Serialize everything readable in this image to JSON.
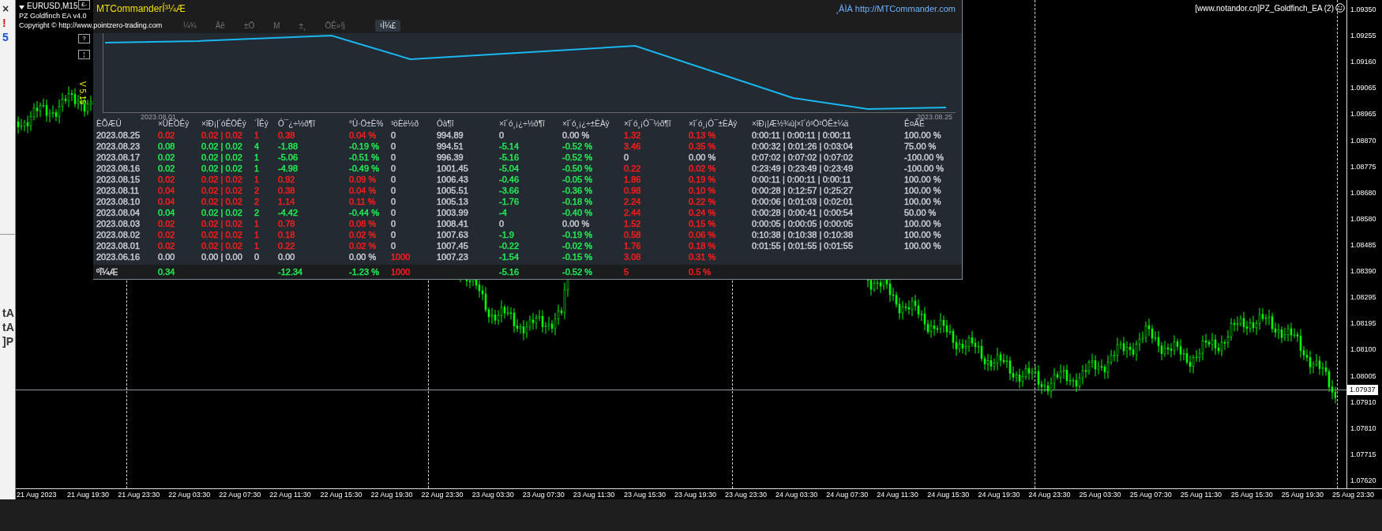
{
  "left_strip": {
    "top": [
      {
        "text": "×",
        "color": "#333333"
      },
      {
        "text": "!",
        "color": "#e01010"
      },
      {
        "text": "5",
        "color": "#1a4fd6"
      }
    ],
    "bottom": [
      {
        "text": "tA",
        "color": "#333333"
      },
      {
        "text": "tA",
        "color": "#333333"
      },
      {
        "text": "]P",
        "color": "#333333"
      }
    ]
  },
  "chart": {
    "symbol": "EURUSD,M15",
    "expert": "PZ Goldfinch EA  v4.0",
    "copyright": "Copyright © http://www.pointzero-trading.com",
    "version": "V 5.15",
    "side_buttons": [
      "£-",
      "?",
      "¦"
    ],
    "info": "[www.notandor.cn]PZ_Goldfinch_EA (2)",
    "current_price": "1.07937",
    "price_axis": [
      "1.09350",
      "1.09255",
      "1.09160",
      "1.09065",
      "1.08965",
      "1.08870",
      "1.08775",
      "1.08680",
      "1.08580",
      "1.08485",
      "1.08390",
      "1.08295",
      "1.08195",
      "1.08100",
      "1.08005",
      "1.07910",
      "1.07810",
      "1.07715",
      "1.07620"
    ],
    "time_axis": [
      "21 Aug 2023",
      "21 Aug 19:30",
      "21 Aug 23:30",
      "22 Aug 03:30",
      "22 Aug 07:30",
      "22 Aug 11:30",
      "22 Aug 15:30",
      "22 Aug 19:30",
      "22 Aug 23:30",
      "23 Aug 03:30",
      "23 Aug 07:30",
      "23 Aug 11:30",
      "23 Aug 15:30",
      "23 Aug 19:30",
      "23 Aug 23:30",
      "24 Aug 03:30",
      "24 Aug 07:30",
      "24 Aug 11:30",
      "24 Aug 15:30",
      "24 Aug 19:30",
      "24 Aug 23:30",
      "25 Aug 03:30",
      "25 Aug 07:30",
      "25 Aug 11:30",
      "25 Aug 15:30",
      "25 Aug 19:30",
      "25 Aug 23:30"
    ]
  },
  "panel": {
    "title": "MTCommanderÍ³¼Æ",
    "link": "¸ÂÌÀ http://MTCommander.com",
    "tabs": [
      {
        "label": "¼¾",
        "selected": false
      },
      {
        "label": "Äê",
        "selected": false
      },
      {
        "label": "±Ö",
        "selected": false
      },
      {
        "label": "M",
        "selected": false
      },
      {
        "label": "±¸",
        "selected": false
      },
      {
        "label": "ÖÊ»§",
        "selected": false
      },
      {
        "label": "¹Ì¼£",
        "selected": true
      }
    ],
    "equity": {
      "start_label": "2023.08.01",
      "end_label": "2023.08.25"
    },
    "table": {
      "columns": [
        "ÈÕÆÚ",
        "×ÜÊÖÊý",
        "×îÐ¡|´óÊÖÊý",
        "´ÎÊý",
        "Ó¯¿÷½ð¶î",
        "°Ù·Ö±È%",
        "³öÈë½ð",
        "Óà¶î",
        "×î´ó¸¡¿÷½ð¶î",
        "×î´ó¸¡¿÷±ÈÀý",
        "×î´ó¸¡Ó¯½ð¶î",
        "×î´ó¸¡Ó¯±ÈÀý",
        "×îÐ¡|Æ½¾ù|×î´ó³Ö²ÖÊ±¼ä",
        "Ê¤ÂÊ"
      ],
      "rows": [
        {
          "cells": [
            {
              "text": "2023.08.25",
              "color": "#c9cdd3"
            },
            {
              "text": "0.02",
              "color": "#ff1c1c"
            },
            {
              "text": "0.02 | 0.02",
              "color": "#ff1c1c"
            },
            {
              "text": "1",
              "color": "#ff1c1c"
            },
            {
              "text": "0.38",
              "color": "#ff1c1c"
            },
            {
              "text": "0.04 %",
              "color": "#ff1c1c"
            },
            {
              "text": "0",
              "color": "#c9cdd3"
            },
            {
              "text": "994.89",
              "color": "#c9cdd3"
            },
            {
              "text": "0",
              "color": "#c9cdd3"
            },
            {
              "text": "0.00 %",
              "color": "#c9cdd3"
            },
            {
              "text": "1.32",
              "color": "#ff1c1c"
            },
            {
              "text": "0.13 %",
              "color": "#ff1c1c"
            },
            {
              "text": "0:00:11 | 0:00:11 | 0:00:11",
              "color": "#c9cdd3"
            },
            {
              "text": "100.00 %",
              "color": "#c9cdd3"
            }
          ]
        },
        {
          "cells": [
            {
              "text": "2023.08.23",
              "color": "#c9cdd3"
            },
            {
              "text": "0.08",
              "color": "#22ee55"
            },
            {
              "text": "0.02 | 0.02",
              "color": "#22ee55"
            },
            {
              "text": "4",
              "color": "#22ee55"
            },
            {
              "text": "-1.88",
              "color": "#22ee55"
            },
            {
              "text": "-0.19 %",
              "color": "#22ee55"
            },
            {
              "text": "0",
              "color": "#c9cdd3"
            },
            {
              "text": "994.51",
              "color": "#c9cdd3"
            },
            {
              "text": "-5.14",
              "color": "#22ee55"
            },
            {
              "text": "-0.52 %",
              "color": "#22ee55"
            },
            {
              "text": "3.46",
              "color": "#ff1c1c"
            },
            {
              "text": "0.35 %",
              "color": "#ff1c1c"
            },
            {
              "text": "0:00:32 | 0:01:26 | 0:03:04",
              "color": "#c9cdd3"
            },
            {
              "text": "75.00 %",
              "color": "#c9cdd3"
            }
          ]
        },
        {
          "cells": [
            {
              "text": "2023.08.17",
              "color": "#c9cdd3"
            },
            {
              "text": "0.02",
              "color": "#22ee55"
            },
            {
              "text": "0.02 | 0.02",
              "color": "#22ee55"
            },
            {
              "text": "1",
              "color": "#22ee55"
            },
            {
              "text": "-5.06",
              "color": "#22ee55"
            },
            {
              "text": "-0.51 %",
              "color": "#22ee55"
            },
            {
              "text": "0",
              "color": "#c9cdd3"
            },
            {
              "text": "996.39",
              "color": "#c9cdd3"
            },
            {
              "text": "-5.16",
              "color": "#22ee55"
            },
            {
              "text": "-0.52 %",
              "color": "#22ee55"
            },
            {
              "text": "0",
              "color": "#c9cdd3"
            },
            {
              "text": "0.00 %",
              "color": "#c9cdd3"
            },
            {
              "text": "0:07:02 | 0:07:02 | 0:07:02",
              "color": "#c9cdd3"
            },
            {
              "text": "-100.00 %",
              "color": "#c9cdd3"
            }
          ]
        },
        {
          "cells": [
            {
              "text": "2023.08.16",
              "color": "#c9cdd3"
            },
            {
              "text": "0.02",
              "color": "#22ee55"
            },
            {
              "text": "0.02 | 0.02",
              "color": "#22ee55"
            },
            {
              "text": "1",
              "color": "#22ee55"
            },
            {
              "text": "-4.98",
              "color": "#22ee55"
            },
            {
              "text": "-0.49 %",
              "color": "#22ee55"
            },
            {
              "text": "0",
              "color": "#c9cdd3"
            },
            {
              "text": "1001.45",
              "color": "#c9cdd3"
            },
            {
              "text": "-5.04",
              "color": "#22ee55"
            },
            {
              "text": "-0.50 %",
              "color": "#22ee55"
            },
            {
              "text": "0.22",
              "color": "#ff1c1c"
            },
            {
              "text": "0.02 %",
              "color": "#ff1c1c"
            },
            {
              "text": "0:23:49 | 0:23:49 | 0:23:49",
              "color": "#c9cdd3"
            },
            {
              "text": "-100.00 %",
              "color": "#c9cdd3"
            }
          ]
        },
        {
          "cells": [
            {
              "text": "2023.08.15",
              "color": "#c9cdd3"
            },
            {
              "text": "0.02",
              "color": "#ff1c1c"
            },
            {
              "text": "0.02 | 0.02",
              "color": "#ff1c1c"
            },
            {
              "text": "1",
              "color": "#ff1c1c"
            },
            {
              "text": "0.92",
              "color": "#ff1c1c"
            },
            {
              "text": "0.09 %",
              "color": "#ff1c1c"
            },
            {
              "text": "0",
              "color": "#c9cdd3"
            },
            {
              "text": "1006.43",
              "color": "#c9cdd3"
            },
            {
              "text": "-0.46",
              "color": "#22ee55"
            },
            {
              "text": "-0.05 %",
              "color": "#22ee55"
            },
            {
              "text": "1.86",
              "color": "#ff1c1c"
            },
            {
              "text": "0.19 %",
              "color": "#ff1c1c"
            },
            {
              "text": "0:00:11 | 0:00:11 | 0:00:11",
              "color": "#c9cdd3"
            },
            {
              "text": "100.00 %",
              "color": "#c9cdd3"
            }
          ]
        },
        {
          "cells": [
            {
              "text": "2023.08.11",
              "color": "#c9cdd3"
            },
            {
              "text": "0.04",
              "color": "#ff1c1c"
            },
            {
              "text": "0.02 | 0.02",
              "color": "#ff1c1c"
            },
            {
              "text": "2",
              "color": "#ff1c1c"
            },
            {
              "text": "0.38",
              "color": "#ff1c1c"
            },
            {
              "text": "0.04 %",
              "color": "#ff1c1c"
            },
            {
              "text": "0",
              "color": "#c9cdd3"
            },
            {
              "text": "1005.51",
              "color": "#c9cdd3"
            },
            {
              "text": "-3.66",
              "color": "#22ee55"
            },
            {
              "text": "-0.36 %",
              "color": "#22ee55"
            },
            {
              "text": "0.98",
              "color": "#ff1c1c"
            },
            {
              "text": "0.10 %",
              "color": "#ff1c1c"
            },
            {
              "text": "0:00:28 | 0:12:57 | 0:25:27",
              "color": "#c9cdd3"
            },
            {
              "text": "100.00 %",
              "color": "#c9cdd3"
            }
          ]
        },
        {
          "cells": [
            {
              "text": "2023.08.10",
              "color": "#c9cdd3"
            },
            {
              "text": "0.04",
              "color": "#ff1c1c"
            },
            {
              "text": "0.02 | 0.02",
              "color": "#ff1c1c"
            },
            {
              "text": "2",
              "color": "#ff1c1c"
            },
            {
              "text": "1.14",
              "color": "#ff1c1c"
            },
            {
              "text": "0.11 %",
              "color": "#ff1c1c"
            },
            {
              "text": "0",
              "color": "#c9cdd3"
            },
            {
              "text": "1005.13",
              "color": "#c9cdd3"
            },
            {
              "text": "-1.76",
              "color": "#22ee55"
            },
            {
              "text": "-0.18 %",
              "color": "#22ee55"
            },
            {
              "text": "2.24",
              "color": "#ff1c1c"
            },
            {
              "text": "0.22 %",
              "color": "#ff1c1c"
            },
            {
              "text": "0:00:06 | 0:01:03 | 0:02:01",
              "color": "#c9cdd3"
            },
            {
              "text": "100.00 %",
              "color": "#c9cdd3"
            }
          ]
        },
        {
          "cells": [
            {
              "text": "2023.08.04",
              "color": "#c9cdd3"
            },
            {
              "text": "0.04",
              "color": "#22ee55"
            },
            {
              "text": "0.02 | 0.02",
              "color": "#22ee55"
            },
            {
              "text": "2",
              "color": "#22ee55"
            },
            {
              "text": "-4.42",
              "color": "#22ee55"
            },
            {
              "text": "-0.44 %",
              "color": "#22ee55"
            },
            {
              "text": "0",
              "color": "#c9cdd3"
            },
            {
              "text": "1003.99",
              "color": "#c9cdd3"
            },
            {
              "text": "-4",
              "color": "#22ee55"
            },
            {
              "text": "-0.40 %",
              "color": "#22ee55"
            },
            {
              "text": "2.44",
              "color": "#ff1c1c"
            },
            {
              "text": "0.24 %",
              "color": "#ff1c1c"
            },
            {
              "text": "0:00:28 | 0:00:41 | 0:00:54",
              "color": "#c9cdd3"
            },
            {
              "text": "50.00 %",
              "color": "#c9cdd3"
            }
          ]
        },
        {
          "cells": [
            {
              "text": "2023.08.03",
              "color": "#c9cdd3"
            },
            {
              "text": "0.02",
              "color": "#ff1c1c"
            },
            {
              "text": "0.02 | 0.02",
              "color": "#ff1c1c"
            },
            {
              "text": "1",
              "color": "#ff1c1c"
            },
            {
              "text": "0.78",
              "color": "#ff1c1c"
            },
            {
              "text": "0.08 %",
              "color": "#ff1c1c"
            },
            {
              "text": "0",
              "color": "#c9cdd3"
            },
            {
              "text": "1008.41",
              "color": "#c9cdd3"
            },
            {
              "text": "0",
              "color": "#c9cdd3"
            },
            {
              "text": "0.00 %",
              "color": "#c9cdd3"
            },
            {
              "text": "1.52",
              "color": "#ff1c1c"
            },
            {
              "text": "0.15 %",
              "color": "#ff1c1c"
            },
            {
              "text": "0:00:05 | 0:00:05 | 0:00:05",
              "color": "#c9cdd3"
            },
            {
              "text": "100.00 %",
              "color": "#c9cdd3"
            }
          ]
        },
        {
          "cells": [
            {
              "text": "2023.08.02",
              "color": "#c9cdd3"
            },
            {
              "text": "0.02",
              "color": "#ff1c1c"
            },
            {
              "text": "0.02 | 0.02",
              "color": "#ff1c1c"
            },
            {
              "text": "1",
              "color": "#ff1c1c"
            },
            {
              "text": "0.18",
              "color": "#ff1c1c"
            },
            {
              "text": "0.02 %",
              "color": "#ff1c1c"
            },
            {
              "text": "0",
              "color": "#c9cdd3"
            },
            {
              "text": "1007.63",
              "color": "#c9cdd3"
            },
            {
              "text": "-1.9",
              "color": "#22ee55"
            },
            {
              "text": "-0.19 %",
              "color": "#22ee55"
            },
            {
              "text": "0.58",
              "color": "#ff1c1c"
            },
            {
              "text": "0.06 %",
              "color": "#ff1c1c"
            },
            {
              "text": "0:10:38 | 0:10:38 | 0:10:38",
              "color": "#c9cdd3"
            },
            {
              "text": "100.00 %",
              "color": "#c9cdd3"
            }
          ]
        },
        {
          "cells": [
            {
              "text": "2023.08.01",
              "color": "#c9cdd3"
            },
            {
              "text": "0.02",
              "color": "#ff1c1c"
            },
            {
              "text": "0.02 | 0.02",
              "color": "#ff1c1c"
            },
            {
              "text": "1",
              "color": "#ff1c1c"
            },
            {
              "text": "0.22",
              "color": "#ff1c1c"
            },
            {
              "text": "0.02 %",
              "color": "#ff1c1c"
            },
            {
              "text": "0",
              "color": "#c9cdd3"
            },
            {
              "text": "1007.45",
              "color": "#c9cdd3"
            },
            {
              "text": "-0.22",
              "color": "#22ee55"
            },
            {
              "text": "-0.02 %",
              "color": "#22ee55"
            },
            {
              "text": "1.76",
              "color": "#ff1c1c"
            },
            {
              "text": "0.18 %",
              "color": "#ff1c1c"
            },
            {
              "text": "0:01:55 | 0:01:55 | 0:01:55",
              "color": "#c9cdd3"
            },
            {
              "text": "100.00 %",
              "color": "#c9cdd3"
            }
          ]
        },
        {
          "cells": [
            {
              "text": "2023.06.16",
              "color": "#c9cdd3"
            },
            {
              "text": "0.00",
              "color": "#c9cdd3"
            },
            {
              "text": "0.00 | 0.00",
              "color": "#c9cdd3"
            },
            {
              "text": "0",
              "color": "#c9cdd3"
            },
            {
              "text": "0.00",
              "color": "#c9cdd3"
            },
            {
              "text": "0.00 %",
              "color": "#c9cdd3"
            },
            {
              "text": "1000",
              "color": "#ff1c1c"
            },
            {
              "text": "1007.23",
              "color": "#c9cdd3"
            },
            {
              "text": "-1.54",
              "color": "#22ee55"
            },
            {
              "text": "-0.15 %",
              "color": "#22ee55"
            },
            {
              "text": "3.08",
              "color": "#ff1c1c"
            },
            {
              "text": "0.31 %",
              "color": "#ff1c1c"
            }
          ]
        }
      ],
      "total": {
        "label": "ºÏ¼Æ",
        "lots": {
          "text": "0.34",
          "color": "#22ee55"
        },
        "profit": {
          "text": "-12.34",
          "color": "#22ee55"
        },
        "percent": {
          "text": "-1.23 %",
          "color": "#22ee55"
        },
        "deposit": {
          "text": "1000",
          "color": "#ff1c1c"
        },
        "float_loss": {
          "text": "-5.16",
          "color": "#22ee55"
        },
        "float_loss_pct": {
          "text": "-0.52 %",
          "color": "#22ee55"
        },
        "float_profit": {
          "text": "5",
          "color": "#ff1c1c"
        },
        "float_profit_pct": {
          "text": "0.5 %",
          "color": "#ff1c1c"
        }
      }
    }
  }
}
